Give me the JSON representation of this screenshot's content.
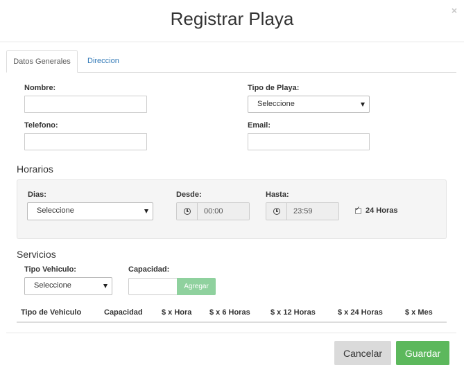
{
  "modal": {
    "title": "Registrar Playa",
    "close_glyph": "×"
  },
  "tabs": [
    {
      "label": "Datos Generales",
      "active": true
    },
    {
      "label": "Direccion",
      "active": false
    }
  ],
  "form": {
    "nombre": {
      "label": "Nombre:",
      "value": ""
    },
    "tipo_playa": {
      "label": "Tipo de Playa:",
      "value": "Seleccione"
    },
    "telefono": {
      "label": "Telefono:",
      "value": ""
    },
    "email": {
      "label": "Email:",
      "value": ""
    }
  },
  "horarios": {
    "section_title": "Horarios",
    "dias": {
      "label": "Dias:",
      "value": "Seleccione"
    },
    "desde": {
      "label": "Desde:",
      "value": "00:00",
      "icon": "clock-icon"
    },
    "hasta": {
      "label": "Hasta:",
      "value": "23:59",
      "icon": "clock-icon"
    },
    "veinticuatro": {
      "label": "24 Horas",
      "checked": true
    }
  },
  "servicios": {
    "section_title": "Servicios",
    "tipo_vehiculo": {
      "label": "Tipo Vehiculo:",
      "value": "Seleccione"
    },
    "capacidad": {
      "label": "Capacidad:",
      "value": ""
    },
    "agregar_label": "Agregar",
    "table_headers": [
      "Tipo de Vehiculo",
      "Capacidad",
      "$ x Hora",
      "$ x 6 Horas",
      "$ x 12 Horas",
      "$ x 24 Horas",
      "$ x Mes"
    ]
  },
  "footer": {
    "cancel_label": "Cancelar",
    "save_label": "Guardar"
  },
  "colors": {
    "primary_link": "#337ab7",
    "success": "#5cb85c",
    "success_light": "#8fd19e",
    "default_btn": "#dadada"
  }
}
